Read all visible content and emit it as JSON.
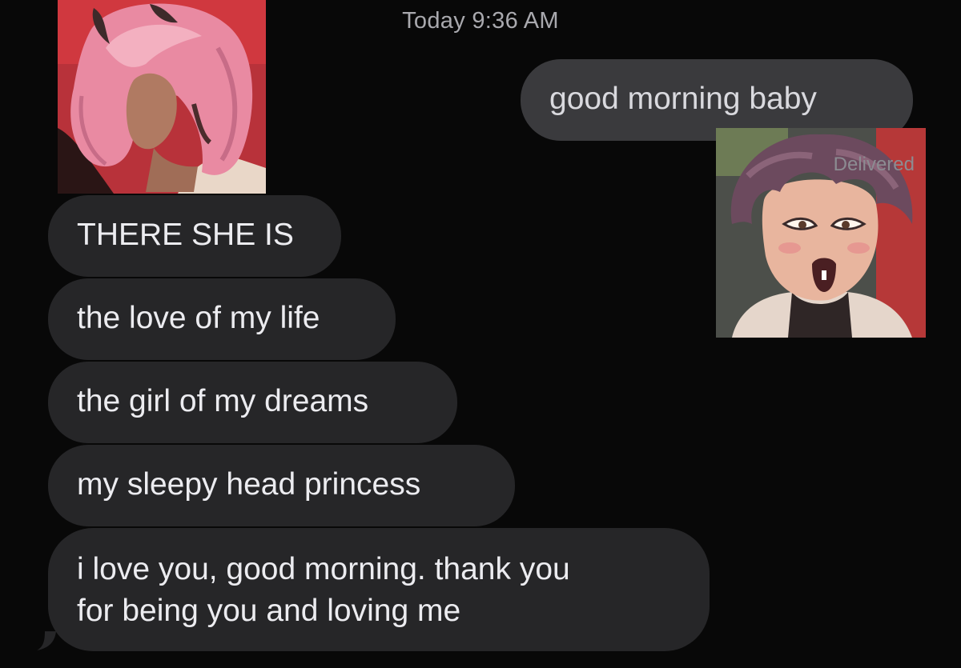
{
  "thread": {
    "timestamp": "Today 9:36 AM",
    "delivered_label": "Delivered"
  },
  "messages": {
    "sent_0": "good morning baby",
    "received_0": "THERE SHE IS",
    "received_1": "the love of my life",
    "received_2": "the girl of my dreams",
    "received_3": "my sleepy head princess",
    "received_4_line1": "i love you, good morning. thank you",
    "received_4_line2": "for being you and loving me"
  },
  "stickers": {
    "left": "pink-haired-horned-character-sticker",
    "right": "curly-haired-surprised-character-sticker"
  },
  "colors": {
    "background": "#080808",
    "received_bubble": "#262628",
    "sent_bubble": "#3a3a3d",
    "timestamp_text": "#a9a9ae"
  }
}
